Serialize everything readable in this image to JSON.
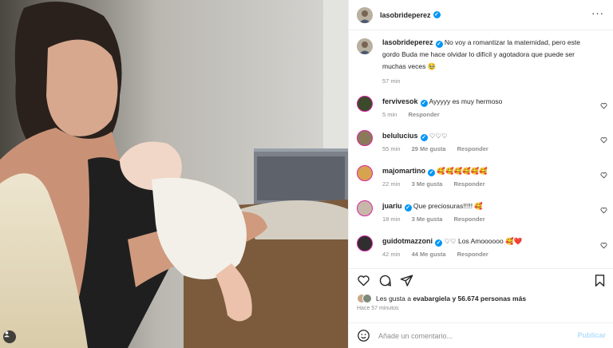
{
  "post": {
    "author": "lasobrideperez",
    "caption": "No voy a romantizar la maternidad, pero este gordo Buda me hace olvidar lo difícil y agotadora que puede ser muchas veces 🥹",
    "caption_time": "57 min"
  },
  "comments": [
    {
      "user": "fervivesok",
      "verified": true,
      "text": "Ayyyyy es muy hermoso",
      "time": "5 min",
      "likes": "",
      "reply": "Responder",
      "avatar_color": "#3b4a2a"
    },
    {
      "user": "belulucius",
      "verified": true,
      "text": "♡♡♡",
      "time": "55 min",
      "likes": "29 Me gusta",
      "reply": "Responder",
      "avatar_color": "#8a7a5a"
    },
    {
      "user": "majomartino",
      "verified": true,
      "text": "🥰🥰🥰🥰🥰🥰",
      "time": "22 min",
      "likes": "3 Me gusta",
      "reply": "Responder",
      "avatar_color": "#d8a34e"
    },
    {
      "user": "juariu",
      "verified": true,
      "text": "Que preciosuras!!!!! 🥰",
      "time": "18 min",
      "likes": "3 Me gusta",
      "reply": "Responder",
      "avatar_color": "#c7b7a8"
    },
    {
      "user": "guidotmazzoni",
      "verified": true,
      "text": "♡♡ Los Amoooooo 🥰❤️",
      "time": "42 min",
      "likes": "44 Me gusta",
      "reply": "Responder",
      "avatar_color": "#2f2f2f"
    }
  ],
  "likes_line": {
    "prefix": "Les gusta a ",
    "user": "evabargiela",
    "suffix": " y 56.674 personas más"
  },
  "time_ago": "Hace 57 minutos",
  "input": {
    "placeholder": "Añade un comentario...",
    "publish": "Publicar"
  },
  "icons": {
    "more": "more-options-icon",
    "heart": "heart-icon",
    "comment": "comment-icon",
    "share": "share-icon",
    "save": "bookmark-icon",
    "emoji": "emoji-icon",
    "user": "user-tag-icon"
  },
  "colors": {
    "accent": "#0095f6",
    "publish_disabled": "#b2dffc",
    "muted": "#8e8e8e",
    "story_ring": "#d6249f"
  }
}
